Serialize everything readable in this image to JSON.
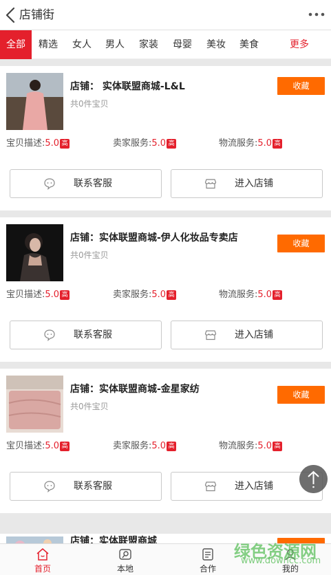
{
  "header": {
    "title": "店铺街",
    "back_icon": "chevron-left-icon",
    "more_icon": "more-dots-icon"
  },
  "tabs": [
    {
      "label": "全部",
      "active": true
    },
    {
      "label": "精选"
    },
    {
      "label": "女人"
    },
    {
      "label": "男人"
    },
    {
      "label": "家装"
    },
    {
      "label": "母婴"
    },
    {
      "label": "美妆"
    },
    {
      "label": "美食"
    },
    {
      "label": "更多"
    }
  ],
  "shops": [
    {
      "name": "店铺： 实体联盟商城-L&L",
      "count": "共0件宝贝",
      "fav": "收藏",
      "ratings": [
        {
          "label": "宝贝描述:",
          "value": "5.0",
          "badge": "高"
        },
        {
          "label": "卖家服务:",
          "value": "5.0",
          "badge": "高"
        },
        {
          "label": "物流服务:",
          "value": "5.0",
          "badge": "高"
        }
      ],
      "contact": "联系客服",
      "enter": "进入店铺"
    },
    {
      "name": "店铺：实体联盟商城-伊人化妆品专卖店",
      "count": "共0件宝贝",
      "fav": "收藏",
      "ratings": [
        {
          "label": "宝贝描述:",
          "value": "5.0",
          "badge": "高"
        },
        {
          "label": "卖家服务:",
          "value": "5.0",
          "badge": "高"
        },
        {
          "label": "物流服务:",
          "value": "5.0",
          "badge": "高"
        }
      ],
      "contact": "联系客服",
      "enter": "进入店铺"
    },
    {
      "name": "店铺：实体联盟商城-金星家纺",
      "count": "共0件宝贝",
      "fav": "收藏",
      "ratings": [
        {
          "label": "宝贝描述:",
          "value": "5.0",
          "badge": "高"
        },
        {
          "label": "卖家服务:",
          "value": "5.0",
          "badge": "高"
        },
        {
          "label": "物流服务:",
          "value": "5.0",
          "badge": "高"
        }
      ],
      "contact": "联系客服",
      "enter": "进入店铺"
    },
    {
      "name": "店铺：实体联盟商城"
    }
  ],
  "tabbar": [
    {
      "label": "首页",
      "icon": "home-icon",
      "active": true
    },
    {
      "label": "本地",
      "icon": "location-icon"
    },
    {
      "label": "合作",
      "icon": "document-icon"
    },
    {
      "label": "我的",
      "icon": "user-icon"
    }
  ],
  "watermark": {
    "text": "绿色资源网",
    "url": "www.downcc.com"
  },
  "colors": {
    "accent": "#e4202c",
    "fav": "#ff6a00",
    "watermark": "#5cc05c"
  }
}
